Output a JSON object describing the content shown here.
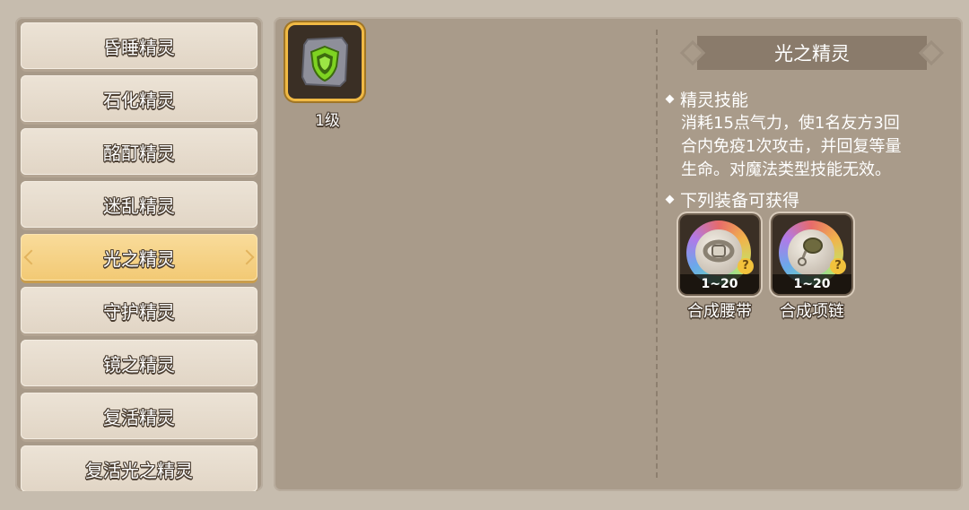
{
  "categories": [
    {
      "label": "昏睡精灵",
      "active": false
    },
    {
      "label": "石化精灵",
      "active": false
    },
    {
      "label": "酩酊精灵",
      "active": false
    },
    {
      "label": "迷乱精灵",
      "active": false
    },
    {
      "label": "光之精灵",
      "active": true
    },
    {
      "label": "守护精灵",
      "active": false
    },
    {
      "label": "镜之精灵",
      "active": false
    },
    {
      "label": "复活精灵",
      "active": false
    },
    {
      "label": "复活光之精灵",
      "active": false
    }
  ],
  "item": {
    "icon": "green-shield-icon",
    "level": "1级"
  },
  "detail": {
    "title": "光之精灵",
    "skill_heading": "精灵技能",
    "skill_lines": [
      "消耗15点气力，使1名友方3回",
      "合内免疫1次攻击，并回复等量",
      "生命。对魔法类型技能无效。"
    ],
    "source_heading": "下列装备可获得",
    "equipment": [
      {
        "name": "合成腰带",
        "range": "1~20",
        "icon": "belt-icon"
      },
      {
        "name": "合成项链",
        "range": "1~20",
        "icon": "necklace-icon"
      }
    ]
  },
  "colors": {
    "accent": "#f2c974",
    "panel": "#a99b8a",
    "slot_border": "#f0b944",
    "shield": "#7ed321"
  }
}
